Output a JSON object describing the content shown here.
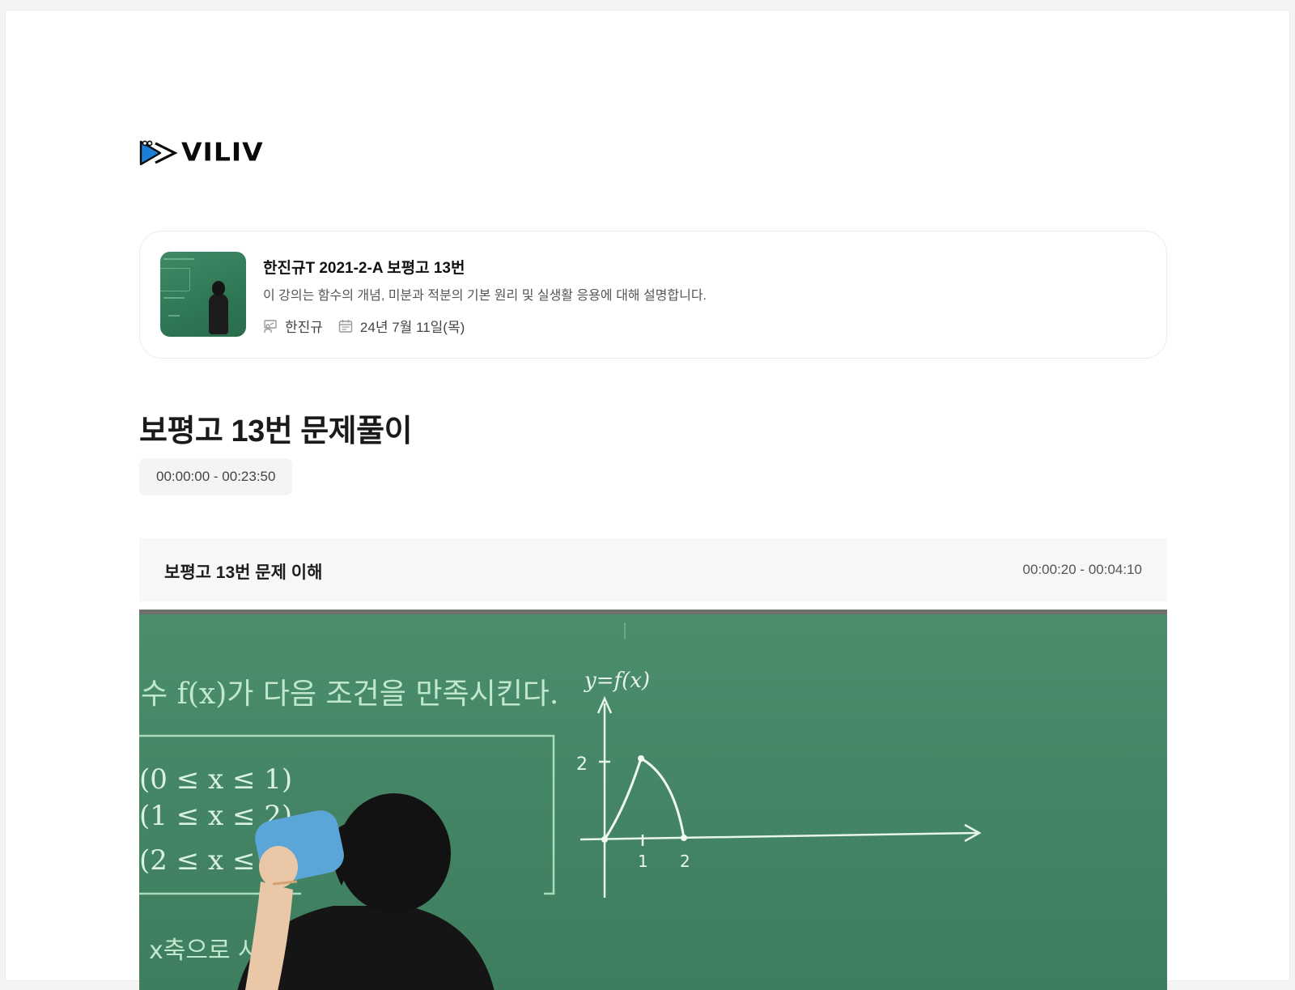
{
  "brand": {
    "name": "VILIV"
  },
  "lecture": {
    "title": "한진규T 2021-2-A 보평고 13번",
    "description": "이 강의는 함수의 개념, 미분과 적분의 기본 원리 및 실생활 응용에 대해 설명합니다.",
    "instructor": "한진규",
    "date": "24년 7월 11일(목)",
    "thumbnail_icon": "lecture-thumbnail"
  },
  "section": {
    "title": "보평고 13번 문제풀이",
    "time_range": "00:00:00 - 00:23:50"
  },
  "chapter": {
    "title": "보평고 13번 문제 이해",
    "time_range": "00:00:20 - 00:04:10"
  },
  "board": {
    "heading": "수  f(x)가 다음 조건을 만족시킨다.",
    "conditions": [
      "(0 ≤ x ≤ 1)",
      "(1 ≤ x ≤ 2)",
      "(2 ≤ x ≤"
    ],
    "footer": "x축으로  사인",
    "graph_label": "y=f(x)",
    "tick_y": "2",
    "tick_x1": "1",
    "tick_x2": "2"
  },
  "icons": {
    "instructor": "teacher-icon",
    "date": "calendar-icon",
    "logo": "play-logo-icon"
  },
  "colors": {
    "accent_blue": "#1b7fd9",
    "board_green": "#458666"
  }
}
